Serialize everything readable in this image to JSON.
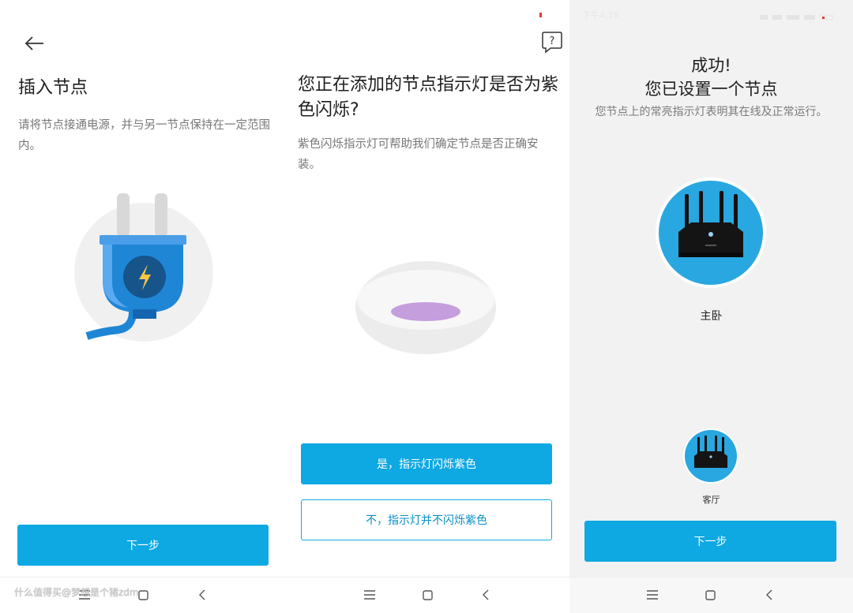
{
  "panel1": {
    "title": "插入节点",
    "description": "请将节点接通电源，并与另一节点保持在一定范围内。",
    "next_button": "下一步",
    "illustration_icon": "power-plug-icon",
    "plug_color": "#1f86d6"
  },
  "panel2": {
    "title": "您正在添加的节点指示灯是否为紫色闪烁?",
    "description": "紫色闪烁指示灯可帮助我们确定节点是否正确安装。",
    "yes_button": "是，指示灯闪烁紫色",
    "no_button": "不，指示灯并不闪烁紫色",
    "help_icon": "help-question-icon",
    "light_color": "#c59ede"
  },
  "panel3": {
    "status_time": "下午4:18",
    "title_line1": "成功!",
    "title_line2": "您已设置一个节点",
    "description": "您节点上的常亮指示灯表明其在线及正常运行。",
    "main_node_label": "主卧",
    "second_node_label": "客厅",
    "next_button": "下一步"
  },
  "watermark": "什么值得买@梦想是个猪zdm",
  "colors": {
    "accent": "#0ea8e3",
    "node_circle": "#29a7e1"
  }
}
